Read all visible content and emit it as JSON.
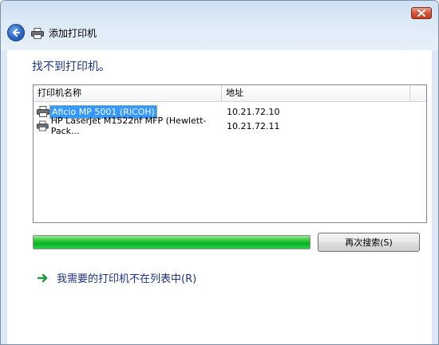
{
  "window": {
    "title": "添加打印机",
    "accent": "#1e3287",
    "close_icon": "close-icon",
    "back_icon": "back-arrow-icon"
  },
  "main": {
    "heading": "找不到打印机。",
    "list": {
      "columns": [
        "打印机名称",
        "地址"
      ],
      "rows": [
        {
          "name": "Aficio MP 5001 (RICOH)",
          "address": "10.21.72.10",
          "selected": true
        },
        {
          "name": "HP LaserJet M1522nf MFP (Hewlett-Pack...",
          "address": "10.21.72.11",
          "selected": false
        }
      ]
    },
    "progress": {
      "value": 1.0,
      "color": "#06b025"
    },
    "search_again_label": "再次搜索(S)",
    "not_listed_link": "我需要的打印机不在列表中(R)"
  }
}
